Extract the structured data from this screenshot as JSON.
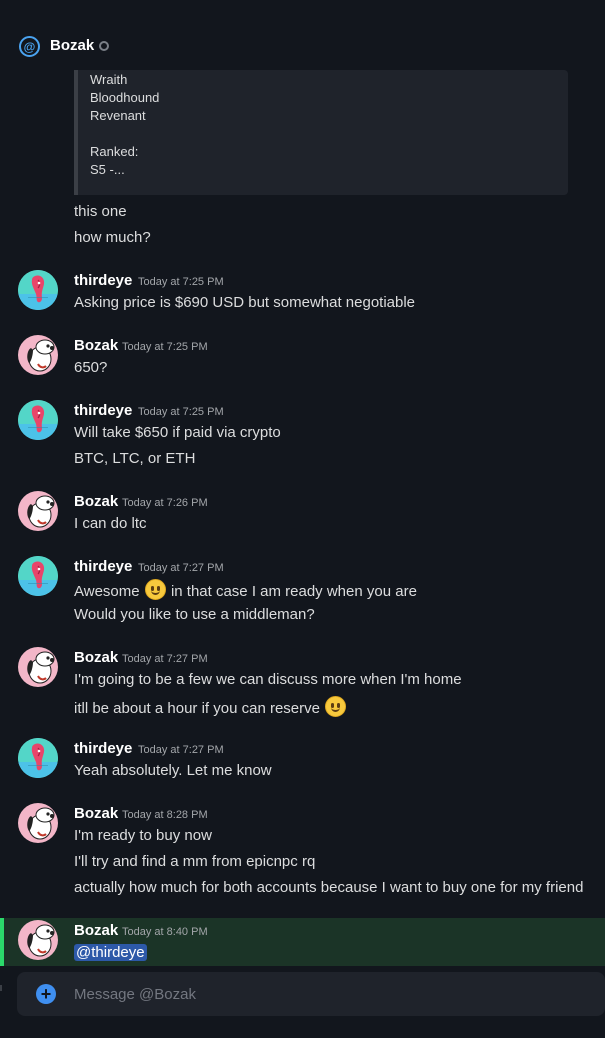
{
  "channel": {
    "name": "Bozak",
    "icon": "at-icon",
    "status": "offline"
  },
  "embed": {
    "lines": [
      "Wraith",
      "Bloodhound",
      "Revenant",
      "",
      "Ranked:",
      "S5 -..."
    ]
  },
  "continuation": [
    "this one",
    "how much?"
  ],
  "messages": [
    {
      "author": "thirdeye",
      "time": "Today at 7:25 PM",
      "avatar": "thirdeye-avatar",
      "lines": [
        "Asking price is $690 USD but somewhat negotiable"
      ]
    },
    {
      "author": "Bozak",
      "time": "Today at 7:25 PM",
      "avatar": "bozak-avatar",
      "lines": [
        "650?"
      ]
    },
    {
      "author": "thirdeye",
      "time": "Today at 7:25 PM",
      "avatar": "thirdeye-avatar",
      "lines": [
        "Will take $650 if paid via crypto",
        "BTC, LTC, or ETH"
      ]
    },
    {
      "author": "Bozak",
      "time": "Today at 7:26 PM",
      "avatar": "bozak-avatar",
      "lines": [
        "I can do ltc"
      ]
    },
    {
      "author": "thirdeye",
      "time": "Today at 7:27 PM",
      "avatar": "thirdeye-avatar",
      "lines": [
        "Awesome",
        "in that case I am ready when you are",
        "Would you like to use a middleman?"
      ]
    },
    {
      "author": "Bozak",
      "time": "Today at 7:27 PM",
      "avatar": "bozak-avatar",
      "lines": [
        "I'm going to be a few we can discuss more when I'm home",
        "itll be about a hour if you can reserve"
      ]
    },
    {
      "author": "thirdeye",
      "time": "Today at 7:27 PM",
      "avatar": "thirdeye-avatar",
      "lines": [
        "Yeah absolutely. Let me know"
      ]
    },
    {
      "author": "Bozak",
      "time": "Today at 8:28 PM",
      "avatar": "bozak-avatar",
      "lines": [
        "I'm ready to buy now",
        "I'll try and find a mm from epicnpc rq",
        "actually how much for both accounts because I want to buy one for my friend"
      ]
    },
    {
      "author": "Bozak",
      "time": "Today at 8:40 PM",
      "avatar": "bozak-avatar",
      "lines": [
        "@thirdeye"
      ]
    }
  ],
  "composer": {
    "placeholder": "Message @Bozak",
    "add_icon": "plus-circle-icon"
  },
  "colors": {
    "background": "#12161d",
    "mention_highlight": "#1b3427",
    "mention_bar": "#2bd96b",
    "accent": "#4aa3f0"
  }
}
